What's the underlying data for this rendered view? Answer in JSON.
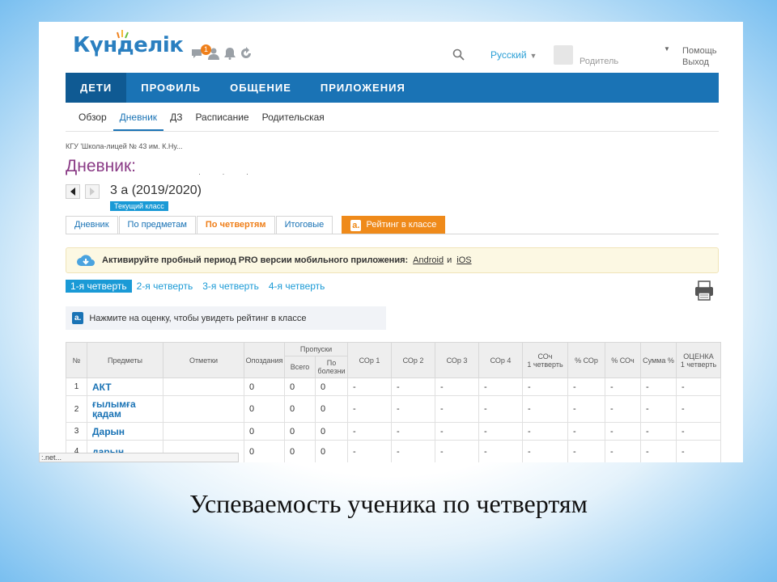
{
  "header": {
    "logo_text": "Күнделік",
    "notification_count": "1",
    "language": "Русский",
    "user_role": "Родитель",
    "help": "Помощь",
    "logout": "Выход"
  },
  "nav": {
    "items": [
      "ДЕТИ",
      "ПРОФИЛЬ",
      "ОБЩЕНИЕ",
      "ПРИЛОЖЕНИЯ"
    ]
  },
  "subnav": {
    "items": [
      "Обзор",
      "Дневник",
      "ДЗ",
      "Расписание",
      "Родительская"
    ]
  },
  "school_name": "КГУ 'Школа-лицей № 43 им. К.Ну...",
  "page_title": "Дневник:",
  "class_label": "3 а (2019/2020)",
  "current_class_tag": "Текущий класс",
  "tabs": {
    "items": [
      "Дневник",
      "По предметам",
      "По четвертям",
      "Итоговые"
    ],
    "rating": "Рейтинг в классе"
  },
  "promo": {
    "text": "Активируйте пробный период PRO версии мобильного приложения:",
    "android": "Android",
    "and": "и",
    "ios": "iOS"
  },
  "quarters": [
    "1-я четверть",
    "2-я четверть",
    "3-я четверть",
    "4-я четверть"
  ],
  "hint": "Нажмите на оценку, чтобы увидеть рейтинг в классе",
  "table": {
    "headers": {
      "num": "№",
      "subjects": "Предметы",
      "marks": "Отметки",
      "late": "Опоздания",
      "absences": "Пропуски",
      "absences_total": "Всего",
      "absences_ill": "По болезни",
      "sor1": "СОр 1",
      "sor2": "СОр 2",
      "sor3": "СОр 3",
      "sor4": "СОр 4",
      "soch": "СОч",
      "soch_sub": "1 четверть",
      "pct_sor": "% СОр",
      "pct_soch": "% СОч",
      "sum_pct": "Сумма %",
      "grade": "ОЦЕНКА",
      "grade_sub": "1 четверть"
    },
    "rows": [
      {
        "n": "1",
        "subject": "АКТ",
        "marks": "",
        "late": "0",
        "total": "0",
        "ill": "0",
        "sor1": "-",
        "sor2": "-",
        "sor3": "-",
        "sor4": "-",
        "soch": "-",
        "pct_sor": "-",
        "pct_soch": "-",
        "sum": "-",
        "grade": "-"
      },
      {
        "n": "2",
        "subject": "ғылымға қадам",
        "marks": "",
        "late": "0",
        "total": "0",
        "ill": "0",
        "sor1": "-",
        "sor2": "-",
        "sor3": "-",
        "sor4": "-",
        "soch": "-",
        "pct_sor": "-",
        "pct_soch": "-",
        "sum": "-",
        "grade": "-"
      },
      {
        "n": "3",
        "subject": "Дарын",
        "marks": "",
        "late": "0",
        "total": "0",
        "ill": "0",
        "sor1": "-",
        "sor2": "-",
        "sor3": "-",
        "sor4": "-",
        "soch": "-",
        "pct_sor": "-",
        "pct_soch": "-",
        "sum": "-",
        "grade": "-"
      },
      {
        "n": "4",
        "subject": "дарын",
        "marks": "",
        "late": "0",
        "total": "0",
        "ill": "0",
        "sor1": "-",
        "sor2": "-",
        "sor3": "-",
        "sor4": "-",
        "soch": "-",
        "pct_sor": "-",
        "pct_soch": "-",
        "sum": "-",
        "grade": "-"
      }
    ]
  },
  "status_url": ":.net...",
  "caption": "Успеваемость  ученика по четвертям",
  "colors": {
    "nav_blue": "#1a73b5",
    "accent_orange": "#ef7f1a",
    "title_purple": "#8a3b86",
    "link_blue": "#1a9ad6"
  }
}
